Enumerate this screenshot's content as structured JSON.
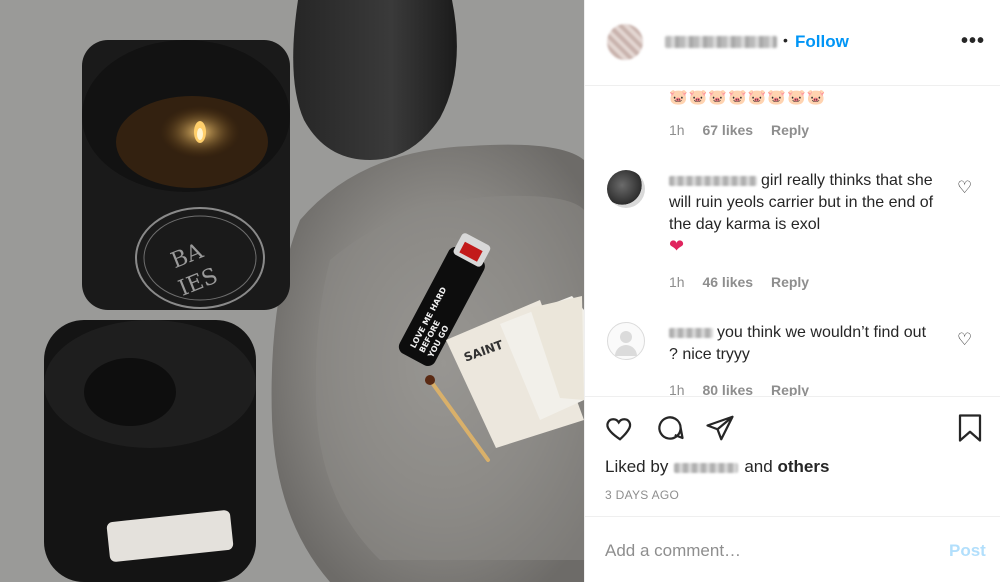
{
  "post": {
    "follow_label": "Follow",
    "separator_dot": "•",
    "more_icon": "ellipsis-icon"
  },
  "comments": [
    {
      "text": "🐷🐷🐷🐷🐷🐷🐷🐷",
      "time": "1h",
      "likes": "67 likes",
      "reply": "Reply"
    },
    {
      "text": "girl really thinks that she will ruin yeols carrier but in the end of the day karma is exol",
      "emoji": "❤",
      "time": "1h",
      "likes": "46 likes",
      "reply": "Reply"
    },
    {
      "text": "you think we wouldn’t find out ? nice tryyy",
      "time": "1h",
      "likes": "80 likes",
      "reply": "Reply"
    }
  ],
  "actions": {
    "liked_by_prefix": "Liked by",
    "liked_by_suffix": "and",
    "others": "others",
    "date": "3 DAYS AGO"
  },
  "composer": {
    "placeholder": "Add a comment…",
    "post_label": "Post"
  },
  "photo_text": {
    "candle_label_top": "BA",
    "candle_label_bottom": "IES",
    "lighter_text": "LOVE ME HARD BEFORE YOU GO",
    "matchbox_text": "SAINT"
  },
  "colors": {
    "accent": "#0095f6",
    "post_disabled": "#b2dffc",
    "muted": "#8e8e8e"
  }
}
